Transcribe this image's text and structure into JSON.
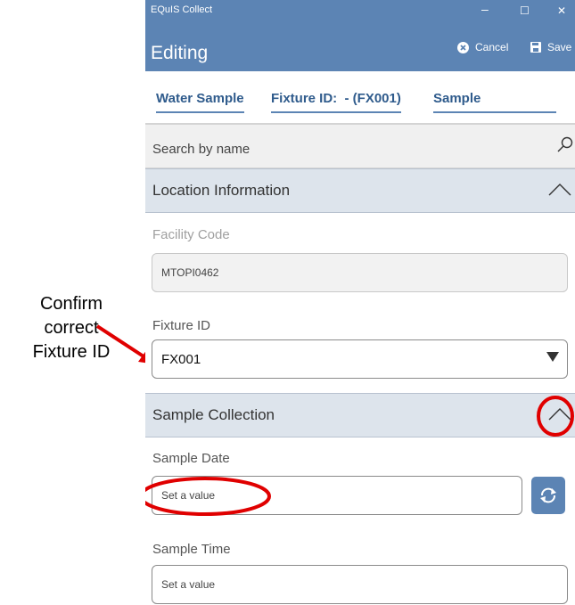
{
  "annotation": {
    "line1": "Confirm",
    "line2": "correct",
    "line3": "Fixture ID"
  },
  "window": {
    "title": "EQuIS Collect",
    "minimize": "–",
    "maximize": "☐",
    "close": "✕"
  },
  "editbar": {
    "heading": "Editing",
    "cancel_label": "Cancel",
    "save_label": "Save"
  },
  "tabs": [
    {
      "label": "Water Sample"
    },
    {
      "label": "Fixture ID:  - (FX001)"
    },
    {
      "label": "Sample"
    }
  ],
  "search": {
    "placeholder": "Search by name"
  },
  "sections": {
    "location": "Location Information",
    "collection": "Sample Collection"
  },
  "fields": {
    "facility_code": {
      "label": "Facility Code",
      "value": "MTOPI0462"
    },
    "fixture_id": {
      "label": "Fixture ID",
      "value": "FX001"
    },
    "sample_date": {
      "label": "Sample Date",
      "placeholder": "Set a value"
    },
    "sample_time": {
      "label": "Sample Time",
      "placeholder": "Set a value"
    }
  },
  "colors": {
    "header": "#5c84b4",
    "tab_text": "#2f5b8c",
    "section_bg": "#dde4ec",
    "annotation_red": "#e00000"
  },
  "icons": [
    "cancel-icon",
    "save-icon",
    "search-icon",
    "chevron-up-icon",
    "dropdown-arrow-icon",
    "refresh-icon"
  ]
}
